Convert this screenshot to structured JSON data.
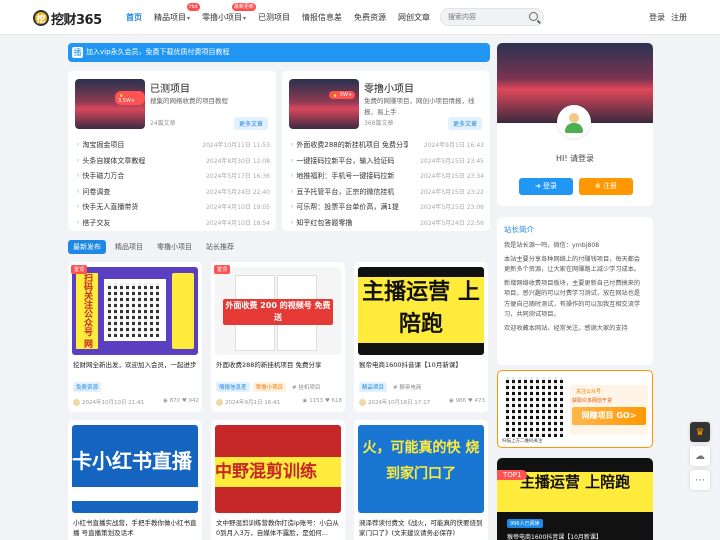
{
  "header": {
    "logo_glyph": "挖",
    "logo_text": "挖财365",
    "nav": [
      {
        "label": "首页",
        "active": true
      },
      {
        "label": "精品项目",
        "badge": "Hot"
      },
      {
        "label": "零撸小项目",
        "badge": "最新更新"
      },
      {
        "label": "已测项目",
        "badge": "已测项目"
      },
      {
        "label": "情报信息差"
      },
      {
        "label": "免费资源"
      },
      {
        "label": "网创文章"
      }
    ],
    "search_placeholder": "搜索内容",
    "login": "登录",
    "register": "注册"
  },
  "notice": {
    "icon": "播",
    "text": "加入vip永久会员，免费下载优质付费项目教程"
  },
  "categories": [
    {
      "title": "已测项目",
      "desc": "搜集的网络收费的项目教程",
      "count": "24篇文章",
      "thumb_badge": "🔥 3.5W+",
      "more": "更多文章",
      "items": [
        {
          "t": "淘宝掘金项目",
          "d": "2024年10月11日 11:53"
        },
        {
          "t": "头条自媒体文章教程",
          "d": "2024年8月30日 12:08"
        },
        {
          "t": "快手磁力万合",
          "d": "2024年5月17日 16:36"
        },
        {
          "t": "问卷调查",
          "d": "2024年5月24日 22:40"
        },
        {
          "t": "快手无人直播带货",
          "d": "2024年4月10日 19:05"
        },
        {
          "t": "搭子交友",
          "d": "2024年4月10日 18:54"
        }
      ]
    },
    {
      "title": "零撸小项目",
      "desc": "免费的网赚项目，网创小项目情报，线报，易上手",
      "count": "368篇文章",
      "thumb_badge": "🔥 5W+",
      "more": "更多文章",
      "items": [
        {
          "t": "外面收费288的新挂机项目 免费分享",
          "d": "2024年9月1日 16:43"
        },
        {
          "t": "一键接码拉新平台，输入验证码",
          "d": "2024年5月25日 23:45"
        },
        {
          "t": "地推福利：手机号一键接码拉新",
          "d": "2024年5月25日 23:34"
        },
        {
          "t": "亘予托管平台，正宗的微信挂机",
          "d": "2024年5月25日 23:22"
        },
        {
          "t": "可乐帮：投票平台单价高，满1提",
          "d": "2024年5月25日 23:06"
        },
        {
          "t": "知乎红包答题零撸",
          "d": "2024年5月24日 22:56"
        }
      ]
    }
  ],
  "tabs": [
    "最新发布",
    "精品项目",
    "零撸小项目",
    "站长推荐"
  ],
  "posts": [
    {
      "flag": "置顶",
      "title": "挖财网全新出发，欢迎加入会员，一起进步",
      "tags": [
        {
          "text": "免费资源",
          "kind": "blue"
        }
      ],
      "date": "2024年10月10日 21:41",
      "views": "870",
      "likes": "942",
      "img_text": "扫码关注公众号 网创干货不迷路"
    },
    {
      "flag": "置顶",
      "title": "外面收费288的新挂机项目 免费分享",
      "tags": [
        {
          "text": "情报信息差",
          "kind": "blue"
        },
        {
          "text": "零撸小项目",
          "kind": "orange"
        },
        {
          "text": "# 挂机项目",
          "kind": "plain"
        }
      ],
      "date": "2024年9月1日 16:41",
      "views": "1153",
      "likes": "618",
      "img_text": "外面收费 200 的视频号 免费送"
    },
    {
      "flag": "",
      "title": "猴帝电商1600抖音课【10月新课】",
      "tags": [
        {
          "text": "精品项目",
          "kind": "blue"
        },
        {
          "text": "# 猴帝电商",
          "kind": "plain"
        }
      ],
      "date": "2024年10月18日 17:17",
      "views": "986",
      "likes": "473",
      "img_text": "主播运营 上陪跑"
    },
    {
      "flag": "",
      "title": "小红书直播实战营，手把手教你做小红书直播 号直播策划及话术",
      "tags": [],
      "date": "",
      "views": "",
      "likes": "",
      "img_text": "卡小红书直播"
    },
    {
      "flag": "",
      "title": "文中野混剪训练营教你打造ip账号：小白从0到月入3万，自媒体不露脸，是如何...",
      "tags": [],
      "date": "",
      "views": "",
      "likes": "",
      "img_text": "中野混剪训练"
    },
    {
      "flag": "",
      "title": "濒泽荐读付费文《战火，可能真的快要烧到家门口了》(文末建议请务必保存)",
      "tags": [],
      "date": "",
      "views": "",
      "likes": "",
      "img_text": "火，可能真的快 烧到家门口了"
    }
  ],
  "sidebar": {
    "greeting": "HI! 请登录",
    "login_btn": "登录",
    "register_btn": "注册",
    "intro_title": "站长简介",
    "intro_paragraphs": [
      "我是站长源一鸣，微信：ymbj808",
      "本站主要分享各种网络上的付赚钱项目，每天都会更新多个资源，让大家在网赚路上减少学习成本。",
      "新增网络收费项目板块，主要更新自己付费搞来的项目，感兴趣的可以付费学习测试，放在网站也是方便自己随时测试，有操作的可以加我互相交流学习，共同测试项目。",
      "欢迎收藏本网站，经常关注。感谢大家的支持"
    ],
    "qr_caption": "扫描上方二维码关注",
    "qr_promo_1": "关注公众号",
    "qr_promo_2": "获取众多网创干货",
    "qr_promo_3": "网赚项目 GO>",
    "top_badge": "TOP1",
    "top_tag": "996人已阅读",
    "top_title": "猴帝电商1600抖音课【10月新课】",
    "top_img_text": "主播运营 上陪跑"
  },
  "floats": [
    "crown-icon",
    "wechat-icon",
    "more-icon"
  ]
}
